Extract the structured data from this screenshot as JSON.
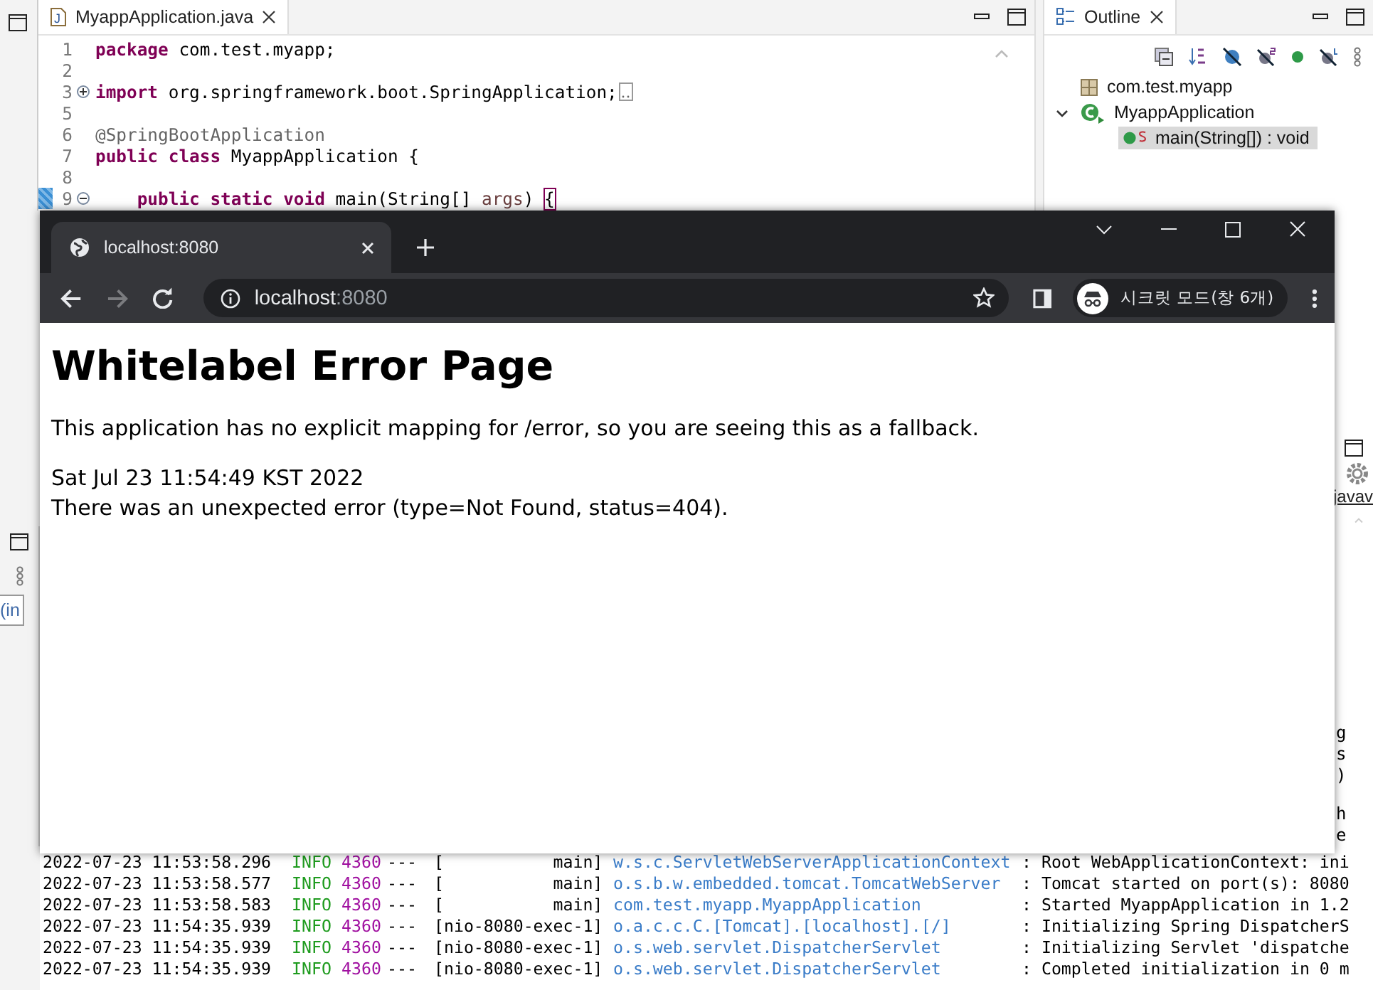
{
  "eclipse": {
    "editor": {
      "tab": {
        "title": "MyappApplication.java",
        "icon_letter": "J"
      },
      "lines": [
        {
          "number": "1",
          "tokens": [
            {
              "text": "package",
              "kind": "keyword"
            },
            {
              "text": " com.test.myapp;",
              "kind": "plain"
            }
          ]
        },
        {
          "number": "2"
        },
        {
          "number": "3",
          "collapsed": true,
          "tokens": [
            {
              "text": "import",
              "kind": "keyword"
            },
            {
              "text": " org.springframework.boot.SpringApplication;",
              "kind": "plain"
            }
          ]
        },
        {
          "number": "5"
        },
        {
          "number": "6",
          "tokens": [
            {
              "text": "@SpringBootApplication",
              "kind": "annotation"
            }
          ]
        },
        {
          "number": "7",
          "tokens": [
            {
              "text": "public class",
              "kind": "keyword"
            },
            {
              "text": " MyappApplication {",
              "kind": "plain"
            }
          ]
        },
        {
          "number": "8"
        },
        {
          "number": "9",
          "collapsed": false,
          "changed": true,
          "tokens": [
            {
              "text": "    public static void",
              "kind": "keyword"
            },
            {
              "text": " main(String[] ",
              "kind": "plain"
            },
            {
              "text": "args",
              "kind": "param"
            },
            {
              "text": ") ",
              "kind": "plain"
            },
            {
              "text": "{",
              "kind": "match"
            }
          ]
        }
      ]
    },
    "outline": {
      "title": "Outline",
      "tree": [
        {
          "label": "com.test.myapp",
          "kind": "package",
          "selected": false
        },
        {
          "label": "MyappApplication",
          "kind": "class",
          "expanded": true,
          "selected": false,
          "children": [
            {
              "label": "main(String[]) : void",
              "kind": "method",
              "static": true,
              "selected": true
            }
          ]
        }
      ]
    },
    "left_view": {
      "field_value": "(in"
    },
    "right_view": {
      "tab_label": "javav",
      "fragments": [
        "g",
        "s",
        ")",
        "h",
        "e"
      ]
    },
    "console": {
      "rows": [
        {
          "time": "2022-07-23 11:53:58.296",
          "level": "INFO",
          "pid": "4360",
          "sep": "---",
          "thread": "[           main]",
          "logger": "w.s.c.ServletWebServerApplicationContext",
          "message": ": Root WebApplicationContext: ini"
        },
        {
          "time": "2022-07-23 11:53:58.577",
          "level": "INFO",
          "pid": "4360",
          "sep": "---",
          "thread": "[           main]",
          "logger": "o.s.b.w.embedded.tomcat.TomcatWebServer",
          "message": ": Tomcat started on port(s): 8080"
        },
        {
          "time": "2022-07-23 11:53:58.583",
          "level": "INFO",
          "pid": "4360",
          "sep": "---",
          "thread": "[           main]",
          "logger": "com.test.myapp.MyappApplication",
          "message": ": Started MyappApplication in 1.2"
        },
        {
          "time": "2022-07-23 11:54:35.939",
          "level": "INFO",
          "pid": "4360",
          "sep": "---",
          "thread": "[nio-8080-exec-1]",
          "logger": "o.a.c.c.C.[Tomcat].[localhost].[/]",
          "message": ": Initializing Spring DispatcherS"
        },
        {
          "time": "2022-07-23 11:54:35.939",
          "level": "INFO",
          "pid": "4360",
          "sep": "---",
          "thread": "[nio-8080-exec-1]",
          "logger": "o.s.web.servlet.DispatcherServlet",
          "message": ": Initializing Servlet 'dispatche"
        },
        {
          "time": "2022-07-23 11:54:35.939",
          "level": "INFO",
          "pid": "4360",
          "sep": "---",
          "thread": "[nio-8080-exec-1]",
          "logger": "o.s.web.servlet.DispatcherServlet",
          "message": ": Completed initialization in 0 m"
        }
      ]
    }
  },
  "browser": {
    "tab": {
      "title": "localhost:8080"
    },
    "nav": {
      "back_enabled": true,
      "forward_enabled": false
    },
    "address": {
      "host": "localhost",
      "port": ":8080"
    },
    "profile": {
      "label": "시크릿 모드(창 6개)"
    },
    "page": {
      "heading": "Whitelabel Error Page",
      "paragraph": "This application has no explicit mapping for /error, so you are seeing this as a fallback.",
      "timestamp": "Sat Jul 23 11:54:49 KST 2022",
      "error": "There was an unexpected error (type=Not Found, status=404)."
    }
  }
}
